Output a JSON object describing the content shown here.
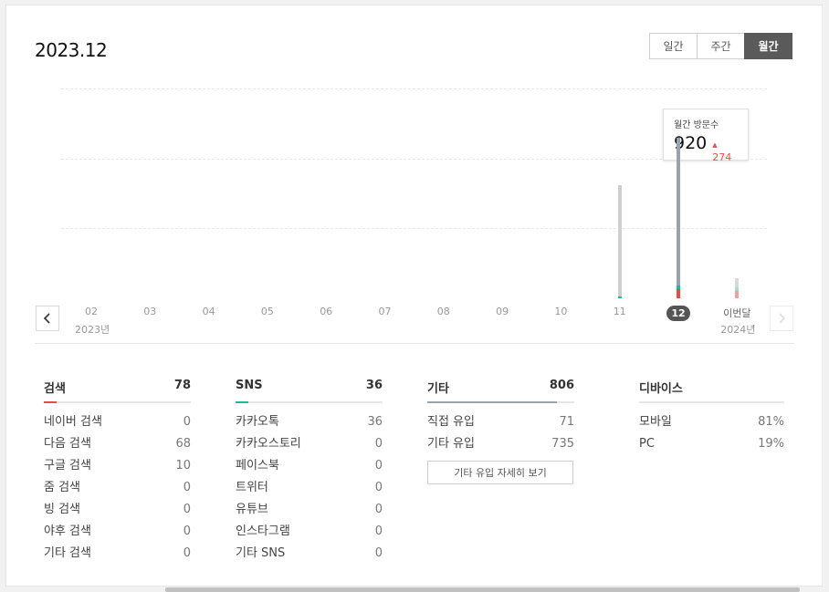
{
  "header": {
    "title": "2023.12"
  },
  "period_tabs": [
    {
      "label": "일간",
      "active": false
    },
    {
      "label": "주간",
      "active": false
    },
    {
      "label": "월간",
      "active": true
    }
  ],
  "chart_data": {
    "type": "bar",
    "categories": [
      "02",
      "03",
      "04",
      "05",
      "06",
      "07",
      "08",
      "09",
      "10",
      "11",
      "12",
      "이번달"
    ],
    "year_labels": [
      {
        "index": 0,
        "label": "2023년"
      },
      {
        "index": 11,
        "label": "2024년"
      }
    ],
    "selected_index": 10,
    "series": [
      {
        "values": [
          0,
          0,
          0,
          0,
          0,
          0,
          0,
          0,
          0,
          646,
          920,
          115
        ]
      }
    ],
    "ylim": [
      0,
      1200
    ],
    "grid": true,
    "colors": {
      "bar": "#9aa3ad",
      "bar_dim": "#cfcfcf",
      "search": "#e84c3d",
      "sns": "#1abc9c"
    }
  },
  "tooltip": {
    "label": "월간 방문수",
    "value": "920",
    "delta_arrow": "▲",
    "delta": "274"
  },
  "stats": {
    "search": {
      "title": "검색",
      "total": "78",
      "share": 0.09,
      "color": "#e84c3d",
      "items": [
        {
          "name": "네이버 검색",
          "value": "0"
        },
        {
          "name": "다음 검색",
          "value": "68"
        },
        {
          "name": "구글 검색",
          "value": "10"
        },
        {
          "name": "줌 검색",
          "value": "0"
        },
        {
          "name": "빙 검색",
          "value": "0"
        },
        {
          "name": "야후 검색",
          "value": "0"
        },
        {
          "name": "기타 검색",
          "value": "0"
        }
      ]
    },
    "sns": {
      "title": "SNS",
      "total": "36",
      "share": 0.04,
      "color": "#1abc9c",
      "items": [
        {
          "name": "카카오톡",
          "value": "36"
        },
        {
          "name": "카카오스토리",
          "value": "0"
        },
        {
          "name": "페이스북",
          "value": "0"
        },
        {
          "name": "트위터",
          "value": "0"
        },
        {
          "name": "유튜브",
          "value": "0"
        },
        {
          "name": "인스타그램",
          "value": "0"
        },
        {
          "name": "기타 SNS",
          "value": "0"
        }
      ]
    },
    "etc": {
      "title": "기타",
      "total": "806",
      "share": 0.88,
      "color": "#9aa3ad",
      "items": [
        {
          "name": "직접 유입",
          "value": "71"
        },
        {
          "name": "기타 유입",
          "value": "735"
        }
      ],
      "detail_button": "기타 유입 자세히 보기"
    },
    "device": {
      "title": "디바이스",
      "items": [
        {
          "name": "모바일",
          "value": "81%"
        },
        {
          "name": "PC",
          "value": "19%"
        }
      ]
    }
  }
}
